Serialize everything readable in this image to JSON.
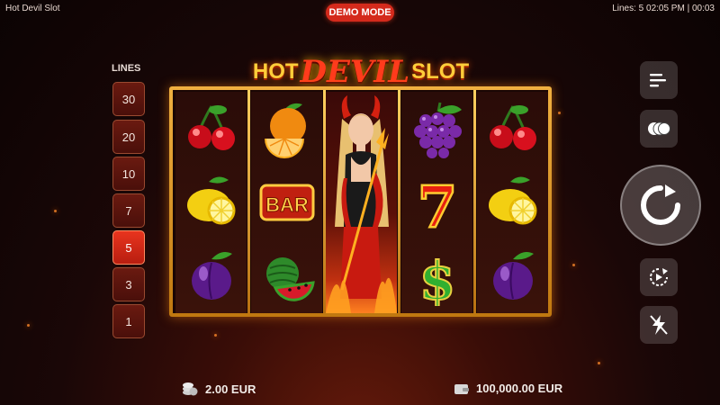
{
  "app": {
    "title": "Hot Devil Slot",
    "status": "Lines: 5  02:05 PM | 00:03",
    "mode_badge": "DEMO MODE"
  },
  "logo": {
    "word1": "HOT",
    "word2": "DEVIL",
    "word3": "SLOT"
  },
  "lines_panel": {
    "label": "LINES",
    "options": [
      "30",
      "20",
      "10",
      "7",
      "5",
      "3",
      "1"
    ],
    "selected": "5"
  },
  "reels": [
    [
      "cherries",
      "lemon",
      "plum"
    ],
    [
      "orange",
      "bar",
      "watermelon"
    ],
    [
      "devil-wild",
      "devil-wild",
      "devil-wild"
    ],
    [
      "grapes",
      "seven",
      "dollar"
    ],
    [
      "cherries",
      "lemon",
      "plum"
    ]
  ],
  "symbols": {
    "bar_text": "BAR",
    "seven_text": "7",
    "dollar_text": "$"
  },
  "controls": {
    "menu_icon": "menu-icon",
    "bet_icon": "coins-icon",
    "spin_icon": "spin-arrow-icon",
    "autoplay_icon": "autoplay-icon",
    "turbo_icon": "lightning-icon"
  },
  "footer": {
    "bet_value": "2.00 EUR",
    "balance_value": "100,000.00 EUR"
  },
  "colors": {
    "accent": "#d42a1c",
    "gold": "#f0b040",
    "active_line": "#e8341e"
  }
}
